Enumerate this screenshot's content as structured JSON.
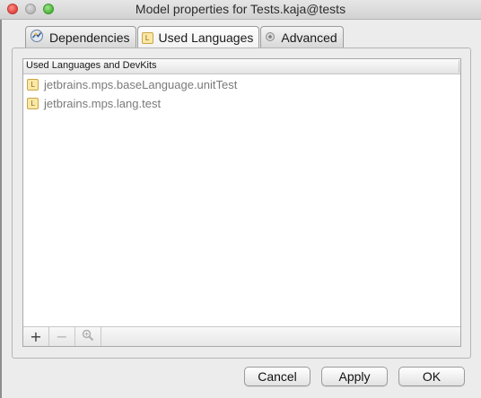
{
  "window": {
    "title": "Model properties for Tests.kaja@tests"
  },
  "tabs": [
    {
      "label": "Dependencies",
      "icon": "dependencies-icon"
    },
    {
      "label": "Used Languages",
      "icon": "language-icon"
    },
    {
      "label": "Advanced",
      "icon": "advanced-icon"
    }
  ],
  "active_tab": "Used Languages",
  "table": {
    "header": "Used Languages and DevKits",
    "rows": [
      {
        "label": "jetbrains.mps.baseLanguage.unitTest",
        "icon_letter": "L"
      },
      {
        "label": "jetbrains.mps.lang.test",
        "icon_letter": "L"
      }
    ]
  },
  "toolbar": {
    "add": "+",
    "remove": "−"
  },
  "buttons": {
    "cancel": "Cancel",
    "apply": "Apply",
    "ok": "OK"
  },
  "tab_icon_letter": "L"
}
